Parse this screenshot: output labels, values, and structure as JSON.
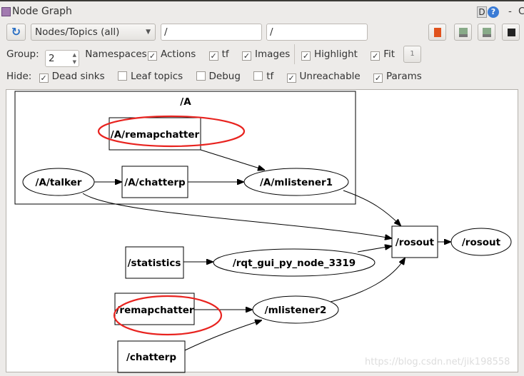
{
  "window": {
    "title": "Node Graph",
    "d_label": "D",
    "help_label": "?",
    "dash": "-",
    "close_partial": "C"
  },
  "toolbar": {
    "refresh_icon": "refresh-icon",
    "mode_select": "Nodes/Topics (all)",
    "filter1": "/",
    "filter2": "/",
    "icons": [
      "open-file-icon",
      "save-dot-icon",
      "save-image-icon",
      "screenshot-icon"
    ]
  },
  "options": {
    "group_label": "Group:",
    "group_value": "2",
    "namespaces": "Namespaces",
    "actions": {
      "label": "Actions",
      "checked": true
    },
    "tf": {
      "label": "tf",
      "checked": true
    },
    "images": {
      "label": "Images",
      "checked": true
    },
    "highlight": {
      "label": "Highlight",
      "checked": true
    },
    "fit": {
      "label": "Fit",
      "checked": true
    },
    "fit_button": "1"
  },
  "hide": {
    "label": "Hide:",
    "dead_sinks": {
      "label": "Dead sinks",
      "checked": true
    },
    "leaf_topics": {
      "label": "Leaf topics",
      "checked": false
    },
    "debug": {
      "label": "Debug",
      "checked": false
    },
    "tf": {
      "label": "tf",
      "checked": false
    },
    "unreachable": {
      "label": "Unreachable",
      "checked": true
    },
    "params": {
      "label": "Params",
      "checked": true
    }
  },
  "check_mark": "✓",
  "graph": {
    "cluster": "/A",
    "nodes": {
      "a_remapchatter": "/A/remapchatter",
      "a_talker": "/A/talker",
      "a_chatterp": "/A/chatterp",
      "a_mlistener1": "/A/mlistener1",
      "rosout_topic": "/rosout",
      "rosout_node": "/rosout",
      "statistics": "/statistics",
      "rqt": "/rqt_gui_py_node_3319",
      "remapchatter": "/remapchatter",
      "mlistener2": "/mlistener2",
      "chatterp": "/chatterp"
    },
    "edges": [
      [
        "/A/talker",
        "/A/chatterp"
      ],
      [
        "/A/chatterp",
        "/A/mlistener1"
      ],
      [
        "/A/remapchatter",
        "/A/mlistener1"
      ],
      [
        "/A/mlistener1",
        "/rosout"
      ],
      [
        "/A/talker",
        "/rosout"
      ],
      [
        "/statistics",
        "/rqt_gui_py_node_3319"
      ],
      [
        "/rqt_gui_py_node_3319",
        "/rosout"
      ],
      [
        "/remapchatter",
        "/mlistener2"
      ],
      [
        "/chatterp",
        "/mlistener2"
      ],
      [
        "/mlistener2",
        "/rosout"
      ],
      [
        "/rosout",
        "/rosout"
      ]
    ],
    "highlight_color": "#e8231f"
  },
  "watermark": "https://blog.csdn.net/jik198558"
}
